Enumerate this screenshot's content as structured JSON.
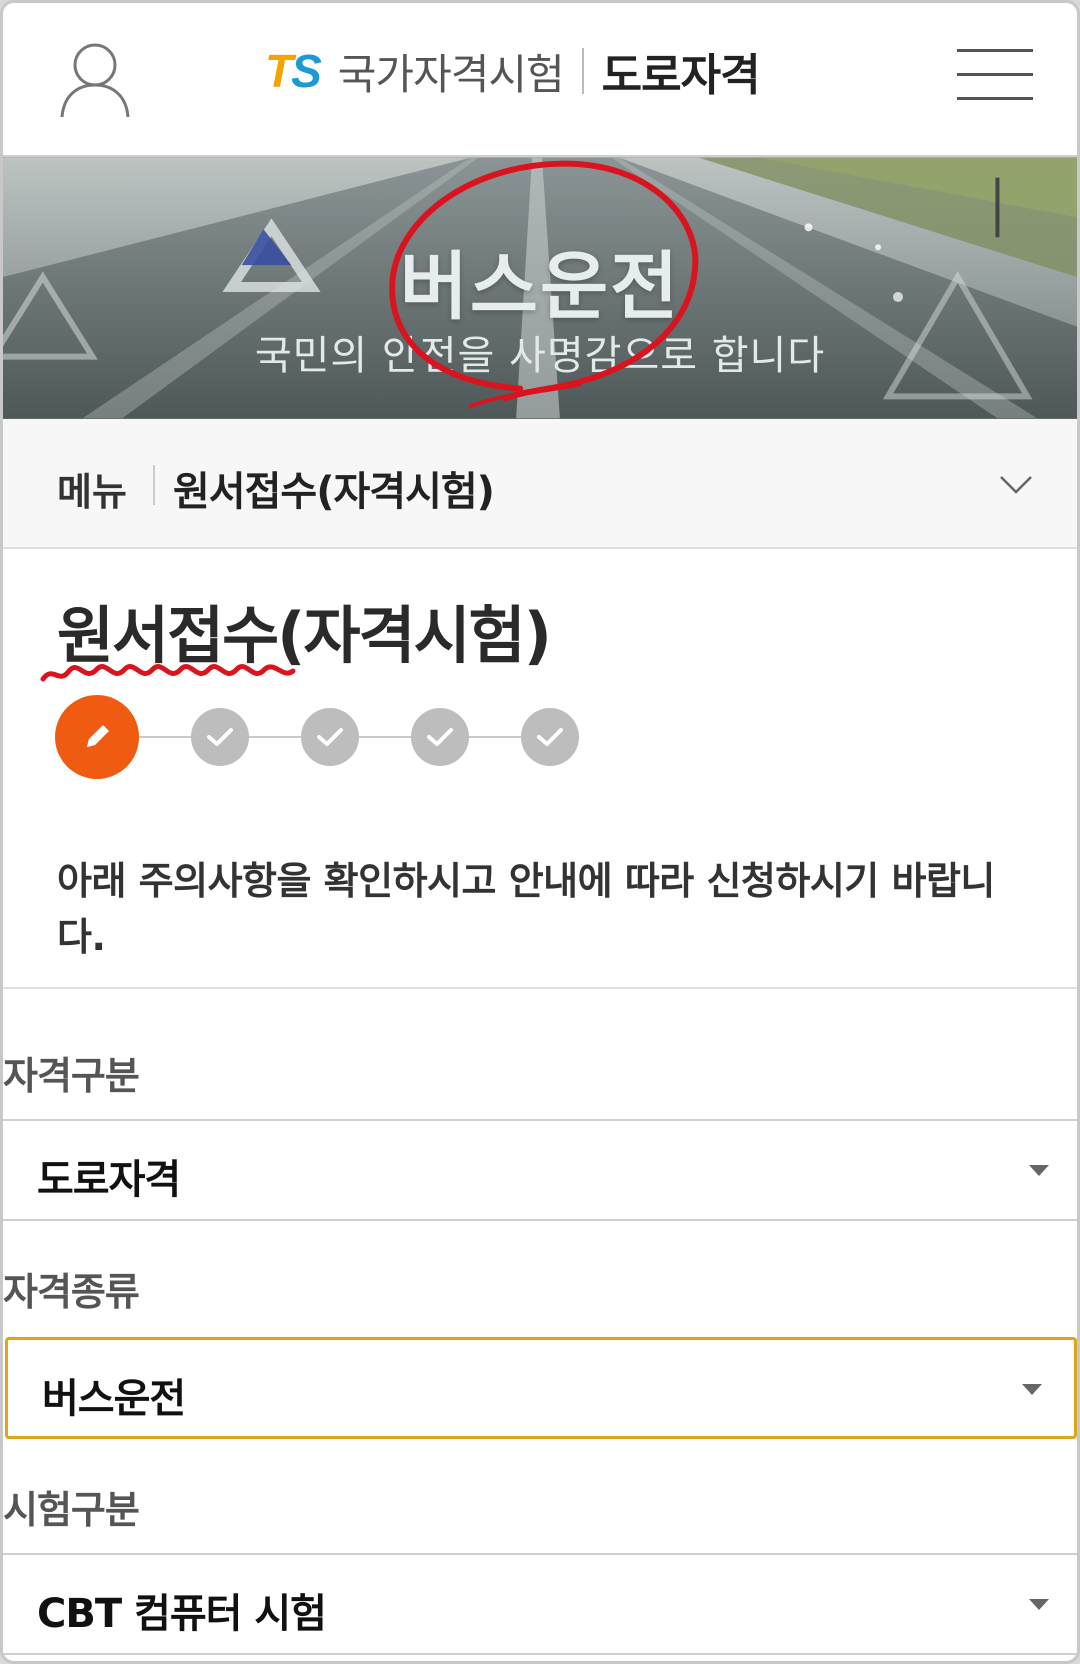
{
  "header": {
    "logo_ts_t": "T",
    "logo_ts_s": "S",
    "logo_text": "국가자격시험",
    "logo_sub": "도로자격"
  },
  "banner": {
    "title": "버스운전",
    "subtitle": "국민의 안전을 사명감으로 합니다"
  },
  "menu_bar": {
    "label": "메뉴",
    "current": "원서접수(자격시험)"
  },
  "page_title": "원서접수(자격시험)",
  "steps": {
    "total": 5,
    "current": 1
  },
  "notice": "아래 주의사항을 확인하시고 안내에 따라 신청하시기 바랍니다.",
  "form": {
    "fields": [
      {
        "label": "자격구분",
        "value": "도로자격"
      },
      {
        "label": "자격종류",
        "value": "버스운전"
      },
      {
        "label": "시험구분",
        "value": "CBT 컴퓨터 시험"
      }
    ]
  },
  "colors": {
    "accent_orange": "#ef5b10",
    "focus_border": "#e0a516",
    "logo_t": "#f2a400",
    "logo_s": "#1b9ad6",
    "annotation_red": "#d9141e"
  },
  "icons": [
    "user-icon",
    "hamburger-menu-icon",
    "chevron-down-icon",
    "pencil-icon",
    "check-icon",
    "dropdown-arrow-icon"
  ]
}
